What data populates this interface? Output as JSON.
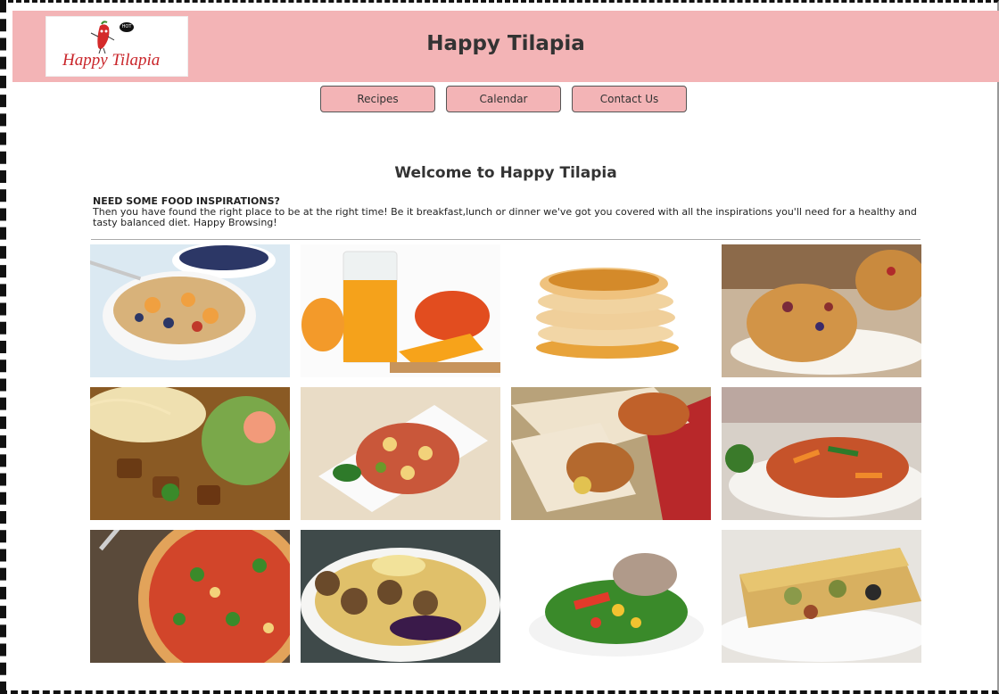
{
  "site": {
    "title": "Happy Tilapia",
    "logo_text": "Happy Tilapia",
    "logo_badge": "HOT"
  },
  "nav": [
    {
      "label": "Recipes"
    },
    {
      "label": "Calendar"
    },
    {
      "label": "Contact Us"
    }
  ],
  "main": {
    "welcome": "Welcome to Happy Tilapia",
    "question": "NEED SOME FOOD INSPIRATIONS?",
    "intro": "Then you have found the right place to be at the right time! Be it breakfast,lunch or dinner we've got you covered with all the inspirations you'll need for a healthy and tasty balanced diet. Happy Browsing!"
  },
  "gallery": [
    {
      "icon": "oatmeal-bowl-image"
    },
    {
      "icon": "orange-juice-image"
    },
    {
      "icon": "pancakes-image"
    },
    {
      "icon": "muffins-image"
    },
    {
      "icon": "beef-stew-image"
    },
    {
      "icon": "chicken-dish-image"
    },
    {
      "icon": "wraps-image"
    },
    {
      "icon": "stir-fry-image"
    },
    {
      "icon": "pizza-image"
    },
    {
      "icon": "meatballs-image"
    },
    {
      "icon": "tuna-salad-image"
    },
    {
      "icon": "lasagna-image"
    }
  ],
  "colors": {
    "header": "#f3b4b6",
    "accent": "#c9252a"
  }
}
